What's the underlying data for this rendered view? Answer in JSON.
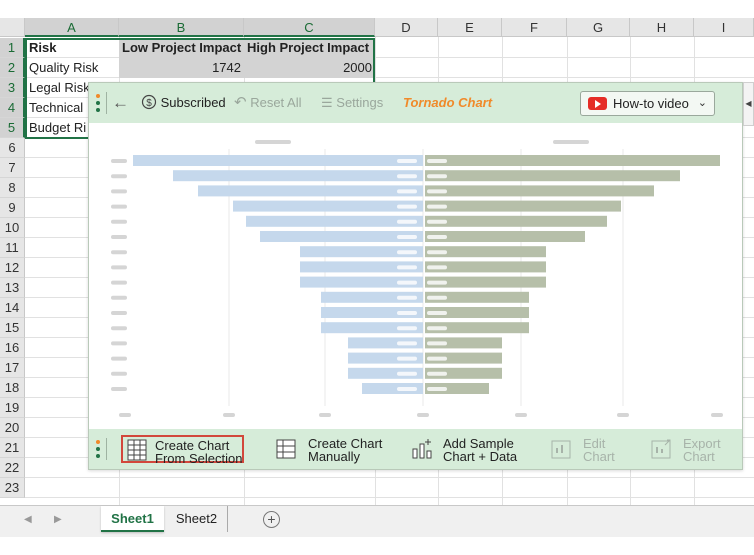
{
  "columns": [
    "A",
    "B",
    "C",
    "D",
    "E",
    "F",
    "G",
    "H",
    "I"
  ],
  "rows": [
    "1",
    "2",
    "3",
    "4",
    "5",
    "6",
    "7",
    "8",
    "9",
    "10",
    "11",
    "12",
    "13",
    "14",
    "15",
    "16",
    "17",
    "18",
    "19",
    "20",
    "21",
    "22",
    "23"
  ],
  "cells": {
    "a1": "Risk",
    "b1": "Low Project Impact",
    "c1": "High Project Impact",
    "a2": "Quality Risk",
    "b2": "1742",
    "c2": "2000",
    "a3": "Legal Risk",
    "a4": "Technical",
    "a5": "Budget Ri"
  },
  "toolbar": {
    "subscribed": "Subscribed",
    "reset_all": "Reset All",
    "settings": "Settings",
    "title": "Tornado Chart",
    "howto": "How-to video"
  },
  "bottom": {
    "create_selection_1": "Create Chart",
    "create_selection_2": "From Selection",
    "create_manual_1": "Create Chart",
    "create_manual_2": "Manually",
    "add_sample_1": "Add Sample",
    "add_sample_2": "Chart + Data",
    "edit_1": "Edit",
    "edit_2": "Chart",
    "export_1": "Export",
    "export_2": "Chart"
  },
  "sheets": [
    "Sheet1",
    "Sheet2"
  ],
  "colors": {
    "accent": "#217346",
    "panel": "#d6ecd9",
    "title": "#f08a2a",
    "left_bar": "#c5d8ec",
    "right_bar": "#b6bfa9",
    "active_outline": "#d2473b"
  },
  "chart_data": {
    "type": "bar",
    "orientation": "horizontal-tornado",
    "placeholder": true,
    "left": [
      290,
      250,
      225,
      190,
      177,
      163,
      123,
      123,
      123,
      102,
      102,
      102,
      75,
      75,
      75,
      61
    ],
    "right": [
      295,
      255,
      229,
      196,
      182,
      160,
      121,
      121,
      121,
      104,
      104,
      104,
      77,
      77,
      77,
      64
    ]
  }
}
